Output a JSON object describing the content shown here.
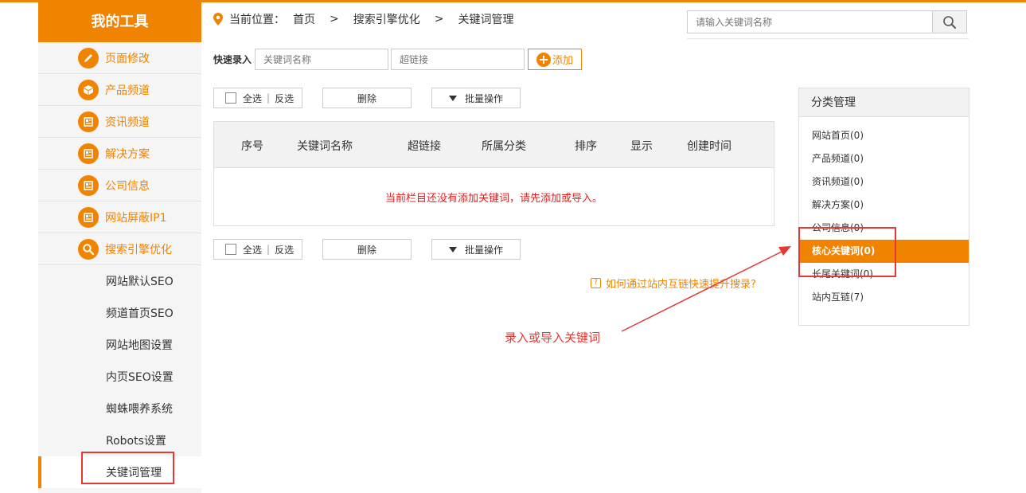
{
  "sidebar": {
    "title": "我的工具",
    "items": [
      {
        "label": "页面修改",
        "icon": "pencil-icon"
      },
      {
        "label": "产品频道",
        "icon": "box-icon"
      },
      {
        "label": "资讯频道",
        "icon": "news-icon"
      },
      {
        "label": "解决方案",
        "icon": "news-icon"
      },
      {
        "label": "公司信息",
        "icon": "news-icon"
      },
      {
        "label": "网站屏蔽IP1",
        "icon": "news-icon"
      },
      {
        "label": "搜索引擎优化",
        "icon": "search-icon"
      }
    ],
    "subitems": [
      {
        "label": "网站默认SEO"
      },
      {
        "label": "频道首页SEO"
      },
      {
        "label": "网站地图设置"
      },
      {
        "label": "内页SEO设置"
      },
      {
        "label": "蜘蛛喂养系统"
      },
      {
        "label": "Robots设置"
      },
      {
        "label": "关键词管理"
      }
    ]
  },
  "breadcrumb": {
    "prefix": "当前位置：",
    "home": "首页",
    "sep": ">",
    "level1": "搜索引擎优化",
    "level2": "关键词管理"
  },
  "search": {
    "placeholder": "请输入关键词名称"
  },
  "quick": {
    "label": "快速录入",
    "name_placeholder": "关键词名称",
    "link_placeholder": "超链接",
    "add_label": "添加"
  },
  "toolbar": {
    "select_all": "全选",
    "bar": "|",
    "invert": "反选",
    "delete": "删除",
    "batch": "批量操作"
  },
  "table": {
    "columns": [
      "序号",
      "关键词名称",
      "超链接",
      "所属分类",
      "排序",
      "显示",
      "创建时间"
    ],
    "empty_message": "当前栏目还没有添加关键词，请先添加或导入。"
  },
  "help_link": "如何通过站内互链快速提升搜录?",
  "annotation": "录入或导入关键词",
  "categories": {
    "title": "分类管理",
    "items": [
      {
        "label": "网站首页(0)"
      },
      {
        "label": "产品频道(0)"
      },
      {
        "label": "资讯频道(0)"
      },
      {
        "label": "解决方案(0)"
      },
      {
        "label": "公司信息(0)"
      },
      {
        "label": "核心关键词(0)"
      },
      {
        "label": "长尾关键词(0)"
      },
      {
        "label": "站内互链(7)"
      }
    ],
    "active_index": 5
  },
  "colors": {
    "accent": "#f08300",
    "highlight": "#e53935"
  }
}
